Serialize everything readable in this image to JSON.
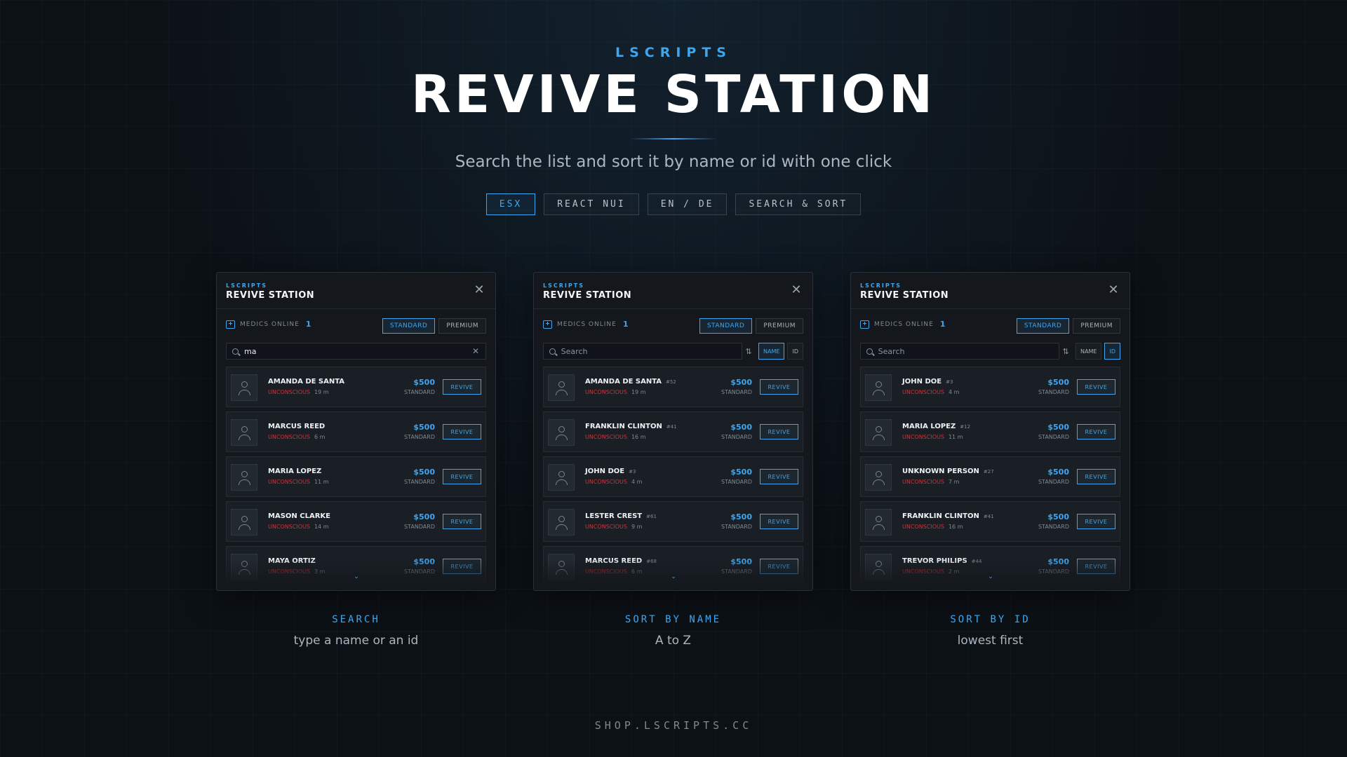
{
  "hero": {
    "brand": "LSCRIPTS",
    "title": "REVIVE STATION",
    "subtitle": "Search the list and sort it by name or id with one click",
    "tags": [
      {
        "label": "ESX",
        "active": true
      },
      {
        "label": "REACT NUI",
        "active": false
      },
      {
        "label": "EN / DE",
        "active": false
      },
      {
        "label": "SEARCH & SORT",
        "active": false
      }
    ]
  },
  "panels": [
    {
      "brand": "LSCRIPTS",
      "title": "REVIVE STATION",
      "medics_label": "MEDICS ONLINE",
      "medics_count": "1",
      "tiers": [
        {
          "label": "STANDARD",
          "active": true
        },
        {
          "label": "PREMIUM",
          "active": false
        }
      ],
      "search_value": "ma",
      "search_placeholder": "Search",
      "show_sort": false,
      "sort": [],
      "rows": [
        {
          "name": "AMANDA DE SANTA",
          "id": "",
          "status": "UNCONSCIOUS",
          "distance": "19 m",
          "price": "$500",
          "tier": "STANDARD",
          "action": "REVIVE"
        },
        {
          "name": "MARCUS REED",
          "id": "",
          "status": "UNCONSCIOUS",
          "distance": "6 m",
          "price": "$500",
          "tier": "STANDARD",
          "action": "REVIVE"
        },
        {
          "name": "MARIA LOPEZ",
          "id": "",
          "status": "UNCONSCIOUS",
          "distance": "11 m",
          "price": "$500",
          "tier": "STANDARD",
          "action": "REVIVE"
        },
        {
          "name": "MASON CLARKE",
          "id": "",
          "status": "UNCONSCIOUS",
          "distance": "14 m",
          "price": "$500",
          "tier": "STANDARD",
          "action": "REVIVE"
        },
        {
          "name": "MAYA ORTIZ",
          "id": "",
          "status": "UNCONSCIOUS",
          "distance": "3 m",
          "price": "$500",
          "tier": "STANDARD",
          "action": "REVIVE"
        }
      ],
      "caption_title": "SEARCH",
      "caption_sub": "type a name or an id"
    },
    {
      "brand": "LSCRIPTS",
      "title": "REVIVE STATION",
      "medics_label": "MEDICS ONLINE",
      "medics_count": "1",
      "tiers": [
        {
          "label": "STANDARD",
          "active": true
        },
        {
          "label": "PREMIUM",
          "active": false
        }
      ],
      "search_value": "",
      "search_placeholder": "Search",
      "show_sort": true,
      "sort": [
        {
          "label": "NAME",
          "active": true
        },
        {
          "label": "ID",
          "active": false
        }
      ],
      "rows": [
        {
          "name": "AMANDA DE SANTA",
          "id": "#52",
          "status": "UNCONSCIOUS",
          "distance": "19 m",
          "price": "$500",
          "tier": "STANDARD",
          "action": "REVIVE"
        },
        {
          "name": "FRANKLIN CLINTON",
          "id": "#41",
          "status": "UNCONSCIOUS",
          "distance": "16 m",
          "price": "$500",
          "tier": "STANDARD",
          "action": "REVIVE"
        },
        {
          "name": "JOHN DOE",
          "id": "#3",
          "status": "UNCONSCIOUS",
          "distance": "4 m",
          "price": "$500",
          "tier": "STANDARD",
          "action": "REVIVE"
        },
        {
          "name": "LESTER CREST",
          "id": "#61",
          "status": "UNCONSCIOUS",
          "distance": "9 m",
          "price": "$500",
          "tier": "STANDARD",
          "action": "REVIVE"
        },
        {
          "name": "MARCUS REED",
          "id": "#68",
          "status": "UNCONSCIOUS",
          "distance": "6 m",
          "price": "$500",
          "tier": "STANDARD",
          "action": "REVIVE"
        }
      ],
      "caption_title": "SORT BY NAME",
      "caption_sub": "A to Z"
    },
    {
      "brand": "LSCRIPTS",
      "title": "REVIVE STATION",
      "medics_label": "MEDICS ONLINE",
      "medics_count": "1",
      "tiers": [
        {
          "label": "STANDARD",
          "active": true
        },
        {
          "label": "PREMIUM",
          "active": false
        }
      ],
      "search_value": "",
      "search_placeholder": "Search",
      "show_sort": true,
      "sort": [
        {
          "label": "NAME",
          "active": false
        },
        {
          "label": "ID",
          "active": true
        }
      ],
      "rows": [
        {
          "name": "JOHN DOE",
          "id": "#3",
          "status": "UNCONSCIOUS",
          "distance": "4 m",
          "price": "$500",
          "tier": "STANDARD",
          "action": "REVIVE"
        },
        {
          "name": "MARIA LOPEZ",
          "id": "#12",
          "status": "UNCONSCIOUS",
          "distance": "11 m",
          "price": "$500",
          "tier": "STANDARD",
          "action": "REVIVE"
        },
        {
          "name": "UNKNOWN PERSON",
          "id": "#27",
          "status": "UNCONSCIOUS",
          "distance": "7 m",
          "price": "$500",
          "tier": "STANDARD",
          "action": "REVIVE"
        },
        {
          "name": "FRANKLIN CLINTON",
          "id": "#41",
          "status": "UNCONSCIOUS",
          "distance": "16 m",
          "price": "$500",
          "tier": "STANDARD",
          "action": "REVIVE"
        },
        {
          "name": "TREVOR PHILIPS",
          "id": "#44",
          "status": "UNCONSCIOUS",
          "distance": "2 m",
          "price": "$500",
          "tier": "STANDARD",
          "action": "REVIVE"
        }
      ],
      "caption_title": "SORT BY ID",
      "caption_sub": "lowest first"
    }
  ],
  "footer": "SHOP.LSCRIPTS.CC",
  "colors": {
    "accent": "#3ea6f0",
    "status": "#c8343a",
    "panel": "#14181d",
    "background": "#0c1116"
  },
  "icons": {
    "close": "close-icon",
    "medic": "medkit-icon",
    "search": "search-icon",
    "clear": "clear-icon",
    "sort": "sort-icon",
    "avatar": "user-icon",
    "more": "chevron-down-icon"
  }
}
